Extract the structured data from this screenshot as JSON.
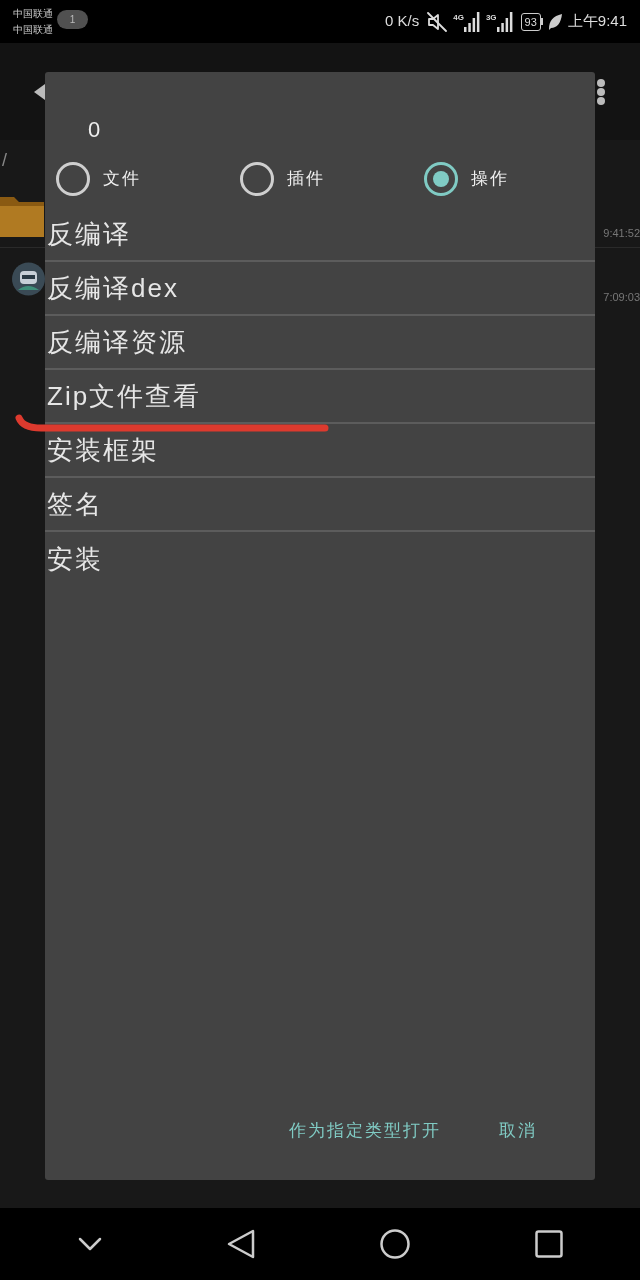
{
  "status_bar": {
    "carriers": [
      "中国联通",
      "中国联通"
    ],
    "notification_count": "1",
    "speed": "0 K/s",
    "signals": [
      {
        "network": "4G"
      },
      {
        "network": "3G"
      }
    ],
    "battery": "93",
    "time": "上午9:41"
  },
  "background": {
    "path": "/",
    "files": [
      {
        "kind": "folder",
        "time": "9:41:52"
      },
      {
        "kind": "app",
        "time": "7:09:03"
      }
    ]
  },
  "dialog": {
    "title": "0",
    "options": [
      {
        "label": "文件",
        "selected": false
      },
      {
        "label": "插件",
        "selected": false
      },
      {
        "label": "操作",
        "selected": true
      }
    ],
    "actions": [
      {
        "label": "反编译",
        "underlined": false
      },
      {
        "label": "反编译dex",
        "underlined": false
      },
      {
        "label": "反编译资源",
        "underlined": false
      },
      {
        "label": "Zip文件查看",
        "underlined": true
      },
      {
        "label": "安装框架",
        "underlined": false
      },
      {
        "label": "签名",
        "underlined": false
      },
      {
        "label": "安装",
        "underlined": false
      }
    ],
    "buttons": [
      {
        "label": "作为指定类型打开"
      },
      {
        "label": "取消"
      }
    ]
  }
}
